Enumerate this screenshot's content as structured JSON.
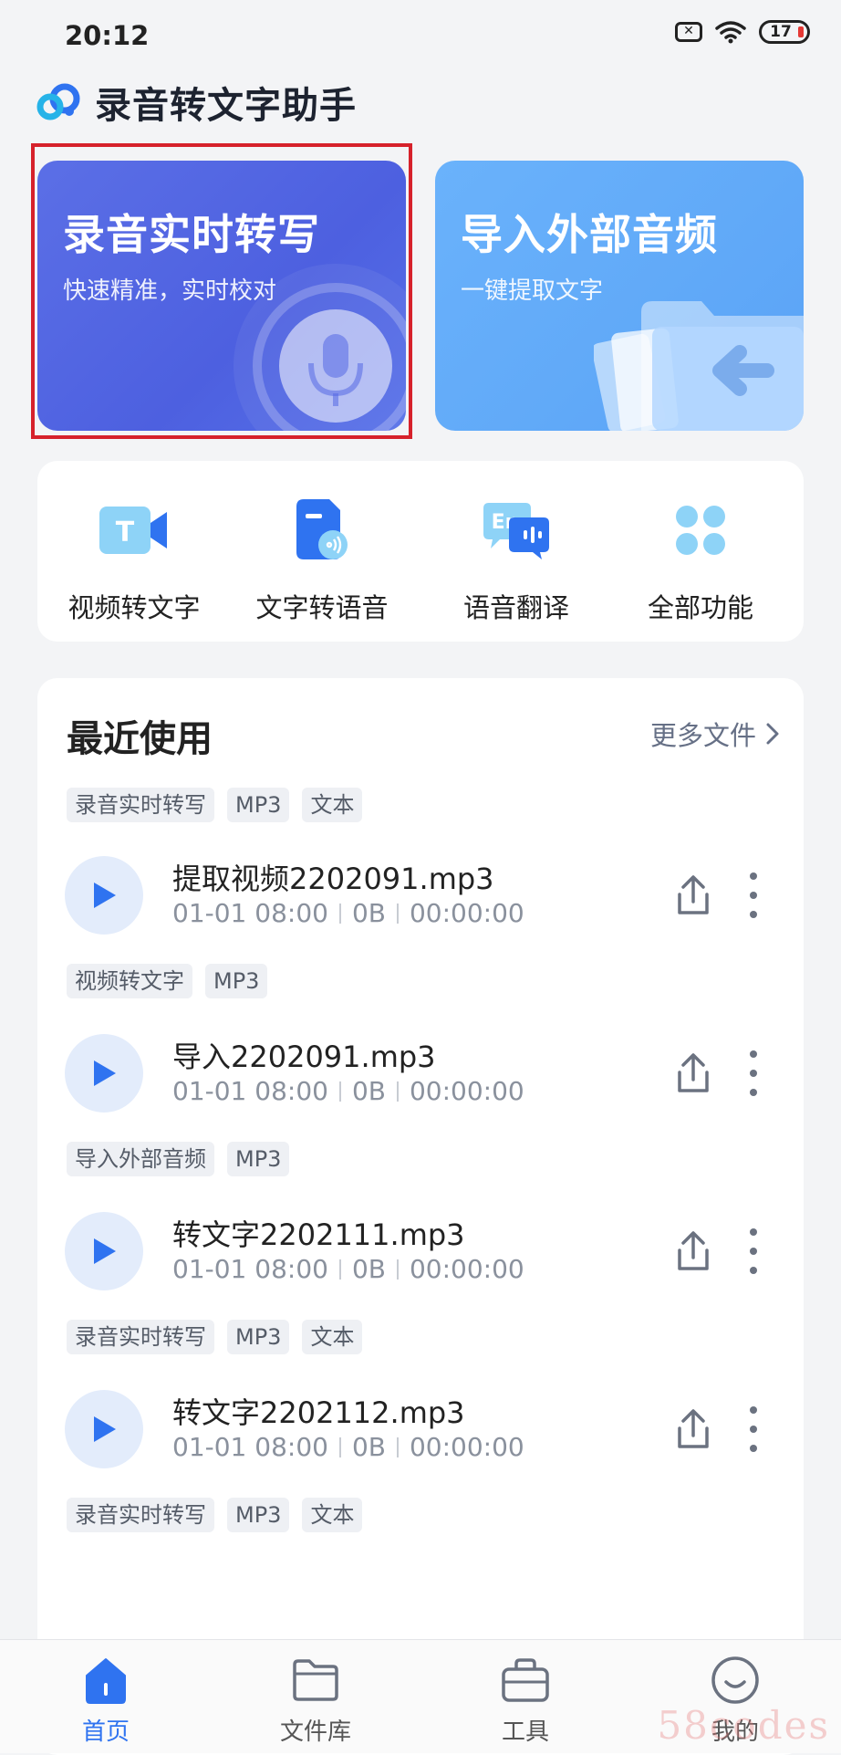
{
  "status_bar": {
    "time": "20:12",
    "battery": "17"
  },
  "app": {
    "title": "录音转文字助手"
  },
  "cards": [
    {
      "title": "录音实时转写",
      "subtitle": "快速精准，实时校对"
    },
    {
      "title": "导入外部音频",
      "subtitle": "一键提取文字"
    }
  ],
  "functions": [
    {
      "label": "视频转文字",
      "icon": "video-text-icon"
    },
    {
      "label": "文字转语音",
      "icon": "text-speech-icon"
    },
    {
      "label": "语音翻译",
      "icon": "translate-icon"
    },
    {
      "label": "全部功能",
      "icon": "all-functions-icon"
    }
  ],
  "recent": {
    "title": "最近使用",
    "more_label": "更多文件",
    "top_tags": [
      "录音实时转写",
      "MP3",
      "文本"
    ],
    "files": [
      {
        "name": "提取视频2202091.mp3",
        "date": "01-01 08:00",
        "size": "0B",
        "duration": "00:00:00",
        "tags": [
          "视频转文字",
          "MP3"
        ]
      },
      {
        "name": "导入2202091.mp3",
        "date": "01-01 08:00",
        "size": "0B",
        "duration": "00:00:00",
        "tags": [
          "导入外部音频",
          "MP3"
        ]
      },
      {
        "name": "转文字2202111.mp3",
        "date": "01-01 08:00",
        "size": "0B",
        "duration": "00:00:00",
        "tags": [
          "录音实时转写",
          "MP3",
          "文本"
        ]
      },
      {
        "name": "转文字2202112.mp3",
        "date": "01-01 08:00",
        "size": "0B",
        "duration": "00:00:00",
        "tags": [
          "录音实时转写",
          "MP3",
          "文本"
        ]
      }
    ]
  },
  "nav": [
    {
      "label": "首页",
      "icon": "home-icon",
      "active": true
    },
    {
      "label": "文件库",
      "icon": "folder-icon",
      "active": false
    },
    {
      "label": "工具",
      "icon": "toolbox-icon",
      "active": false
    },
    {
      "label": "我的",
      "icon": "profile-icon",
      "active": false
    }
  ],
  "watermark": "58codes",
  "colors": {
    "accent": "#2f73f0",
    "card_realtime": "#5468e4",
    "card_import": "#62abf8",
    "highlight": "#d6212b"
  }
}
